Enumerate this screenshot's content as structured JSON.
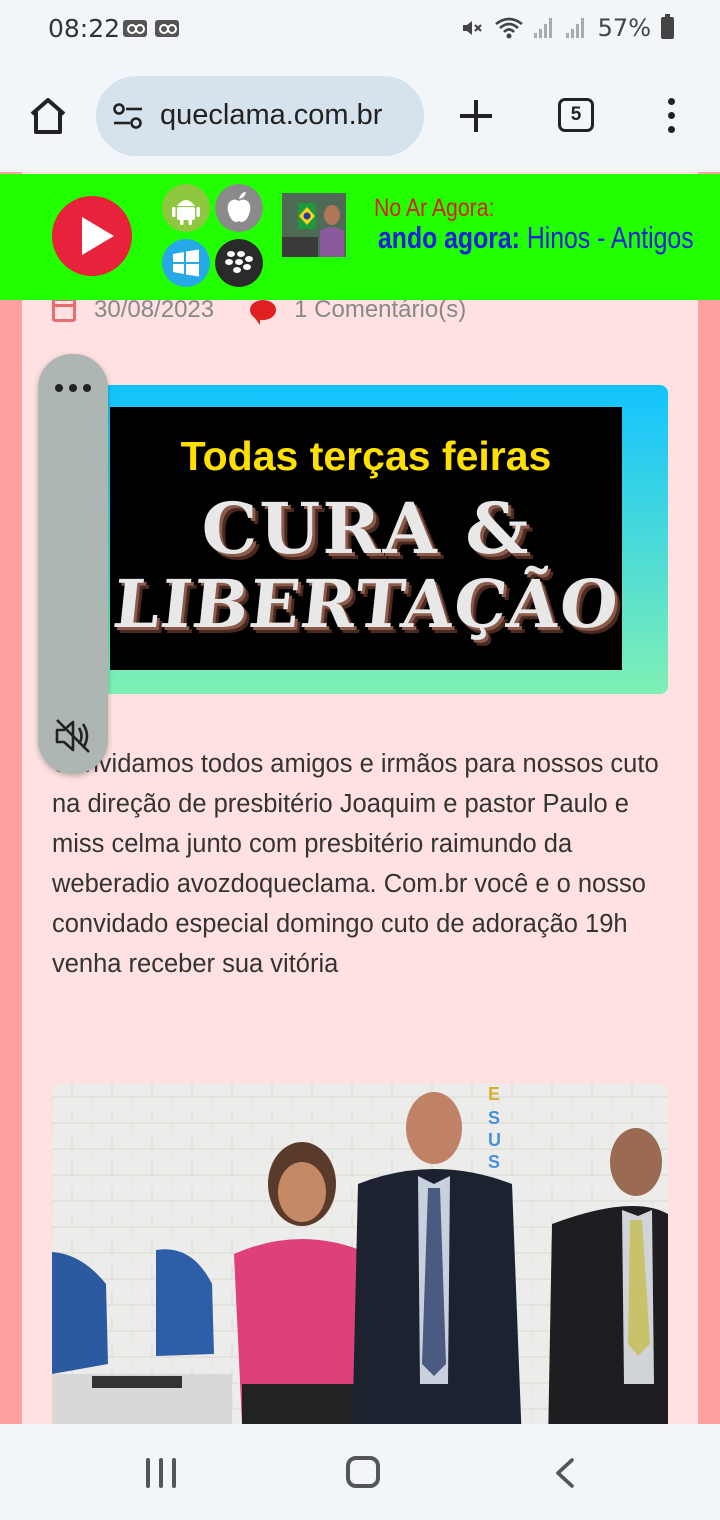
{
  "status_bar": {
    "time": "08:22",
    "battery": "57%",
    "icons": [
      "voicemail-icon",
      "voicemail-icon",
      "mute-icon",
      "wifi-icon",
      "signal-icon",
      "signal-icon",
      "battery-icon"
    ]
  },
  "browser": {
    "url": "queclama.com.br",
    "tab_count": "5",
    "icons": [
      "home-icon",
      "site-settings-icon",
      "new-tab-icon",
      "tabs-icon",
      "more-menu-icon"
    ]
  },
  "player": {
    "on_air_label": "No Ar Agora:",
    "now_playing_label": "ando agora:",
    "now_playing_value": "Hinos - Antigos",
    "platform_icons": [
      "android-icon",
      "apple-icon",
      "windows-icon",
      "blackberry-icon"
    ],
    "colors": {
      "bar": "#22ff00",
      "play": "#e8223a",
      "on_air": "#d62020",
      "now_playing": "#1c22d8"
    }
  },
  "post": {
    "date": "30/08/2023",
    "comments": "1 Comentário(s)",
    "banner": {
      "top_text": "Todas terças feiras",
      "word1": "CURA &",
      "word2": "LIBERTAÇÃO"
    },
    "body": "Convidamos todos amigos e irmãos para nossos cuto na direção de presbitério Joaquim e pastor Paulo e miss celma junto com presbitério raimundo da weberadio avozdoqueclama. Com.br você e o nosso convidado especial domingo cuto de adoração 19h venha receber sua vitória",
    "photo_sign_letters": "ESUS"
  },
  "side_widget": {
    "icons": [
      "more-options-icon",
      "muted-speaker-icon"
    ]
  },
  "nav": {
    "icons": [
      "recent-apps-icon",
      "home-nav-icon",
      "back-icon"
    ]
  }
}
